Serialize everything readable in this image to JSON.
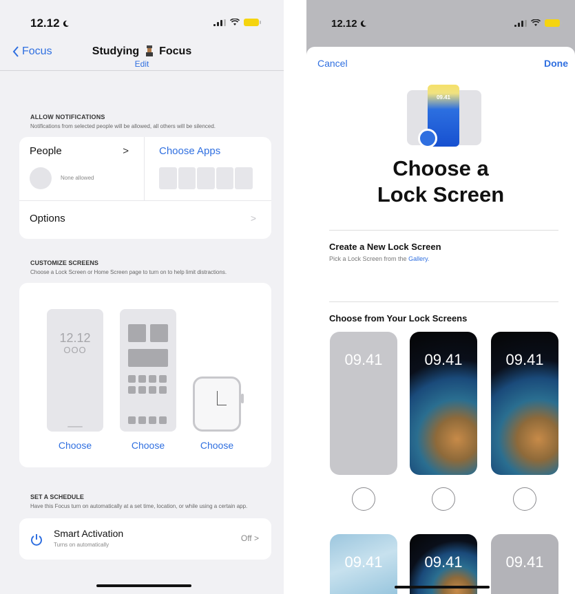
{
  "left": {
    "status": {
      "time": "12.12"
    },
    "nav": {
      "back_label": "Focus",
      "title_pre": "Studying",
      "title_post": "Focus",
      "edit": "Edit"
    },
    "allow": {
      "heading": "ALLOW NOTIFICATIONS",
      "desc": "Notifications from selected people will be allowed, all others will be silenced.",
      "people_label": "People",
      "people_chevron": ">",
      "people_none": "None allowed",
      "apps_label": "Choose Apps",
      "options_label": "Options",
      "options_chevron": ">"
    },
    "customize": {
      "heading": "CUSTOMIZE SCREENS",
      "desc": "Choose a Lock Screen or Home Screen page to turn on to help limit distractions.",
      "lock_time": "12.12",
      "lock_dots": "OOO",
      "choose_1": "Choose",
      "choose_2": "Choose",
      "choose_3": "Choose"
    },
    "schedule": {
      "heading": "SET A SCHEDULE",
      "desc": "Have this Focus turn on automatically at a set time, location, or while using a certain app.",
      "smart_title": "Smart Activation",
      "smart_sub": "Turns on automatically",
      "smart_value": "Off >"
    }
  },
  "right": {
    "status": {
      "time": "12.12"
    },
    "cancel": "Cancel",
    "done": "Done",
    "hero_time": "09.41",
    "title_line1": "Choose a",
    "title_line2": "Lock Screen",
    "new_title": "Create a New Lock Screen",
    "new_sub_pre": "Pick a Lock Screen from the ",
    "new_sub_link": "Gallery.",
    "from_title": "Choose from Your Lock Screens",
    "thumb_time": "09.41",
    "thumb_times": [
      "09.41",
      "09.41",
      "09.41",
      "09.41",
      "09.41",
      "09.41"
    ]
  },
  "colors": {
    "accent": "#2f6fe0",
    "battery": "#f5d40f"
  }
}
